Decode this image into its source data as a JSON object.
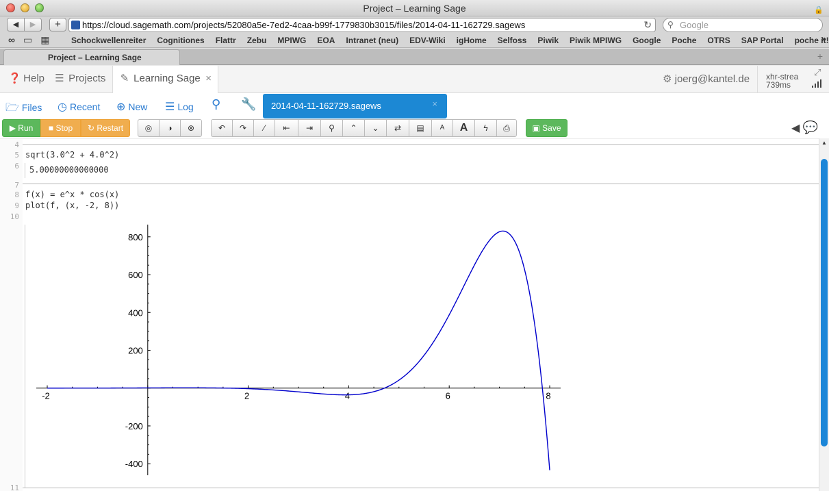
{
  "window": {
    "title": "Project – Learning Sage"
  },
  "browser": {
    "url": "https://cloud.sagemath.com/projects/52080a5e-7ed2-4caa-b99f-1779830b3015/files/2014-04-11-162729.sagews",
    "search_placeholder": "Google",
    "bookmarks": [
      "Schockwellenreiter",
      "Cognitiones",
      "Flattr",
      "Zebu",
      "MPIWG",
      "EOA",
      "Intranet (neu)",
      "EDV-Wiki",
      "igHome",
      "Selfoss",
      "Piwik",
      "Piwik MPIWG",
      "Google",
      "Poche",
      "OTRS",
      "SAP Portal",
      "poche it!"
    ],
    "tab_title": "Project – Learning Sage"
  },
  "nav": {
    "help": "Help",
    "projects": "Projects",
    "project_tab": "Learning Sage",
    "user": "joerg@kantel.de",
    "xhr_line1": "xhr-strea",
    "xhr_line2": "739ms"
  },
  "filebar": {
    "files": "Files",
    "recent": "Recent",
    "new": "New",
    "log": "Log",
    "open_file": "2014-04-11-162729.sagews"
  },
  "buttons": {
    "run": "Run",
    "stop": "Stop",
    "restart": "Restart",
    "save": "Save"
  },
  "editor": {
    "line_numbers": [
      "4",
      "5",
      "6",
      "7",
      "8",
      "9",
      "10",
      "11"
    ],
    "cell1_code": "sqrt(3.0^2 + 4.0^2)",
    "cell1_output": "5.00000000000000",
    "cell2_line1": "f(x) = e^x * cos(x)",
    "cell2_line2": "plot(f, (x, -2, 8))"
  },
  "colors": {
    "accent_blue": "#1c88d4",
    "run_green": "#5cb85c",
    "stop_orange": "#f0ad4e",
    "plot_line": "#0000cc"
  },
  "chart_data": {
    "type": "line",
    "function": "e^x * cos(x)",
    "xlim": [
      -2,
      8
    ],
    "ylim": [
      -450,
      850
    ],
    "x_ticks": [
      -2,
      2,
      4,
      6,
      8
    ],
    "y_ticks": [
      800,
      600,
      400,
      200,
      -200,
      -400
    ],
    "series": [
      {
        "x": [
          -2,
          -1,
          0,
          1,
          2,
          3,
          4,
          4.5,
          5,
          6,
          7,
          7.1,
          7.5,
          8
        ],
        "y": [
          -0.06,
          0.2,
          1,
          1.47,
          -3.08,
          -19.88,
          -35.69,
          -19.0,
          42.09,
          387.0,
          825.0,
          830.0,
          631.0,
          -433.0
        ]
      }
    ]
  }
}
